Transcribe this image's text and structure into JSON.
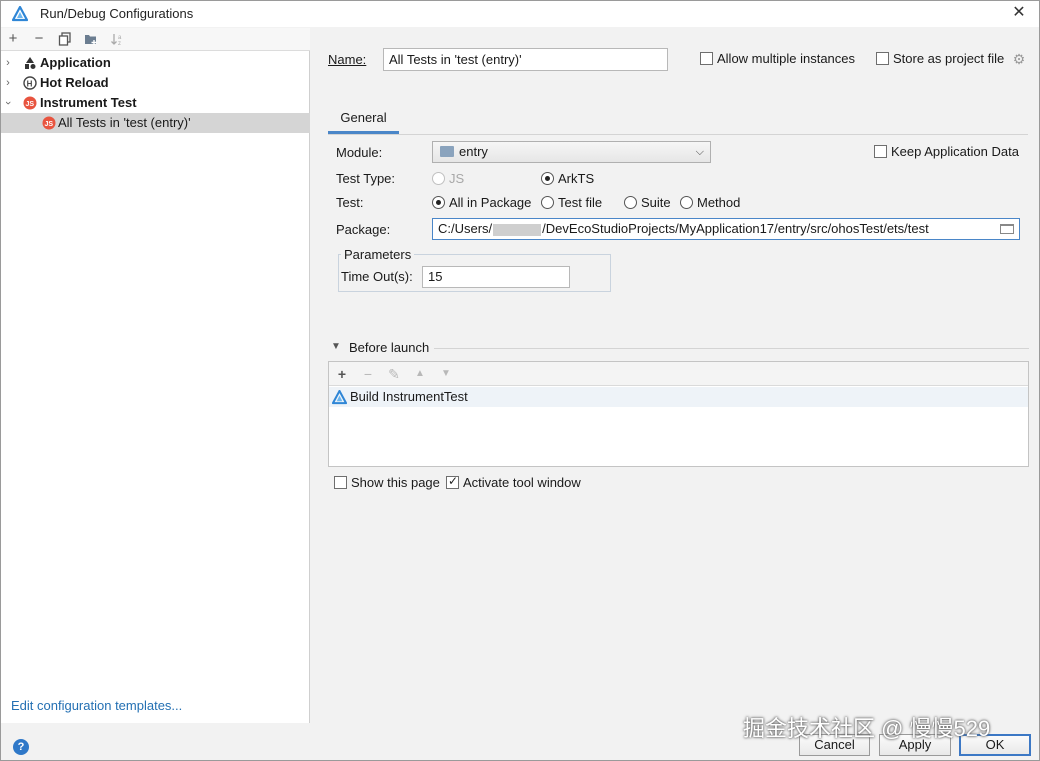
{
  "window": {
    "title": "Run/Debug Configurations",
    "close_icon": "close-icon"
  },
  "left_toolbar": {
    "icons": [
      "plus-icon",
      "minus-icon",
      "copy-icon",
      "folder-add-icon",
      "sort-icon"
    ],
    "plus": "+",
    "minus": "−"
  },
  "tree": {
    "items": [
      {
        "label": "Application",
        "icon": "application-icon",
        "expanded": false
      },
      {
        "label": "Hot Reload",
        "icon": "hot-reload-icon",
        "expanded": false
      },
      {
        "label": "Instrument Test",
        "icon": "js-test-icon",
        "expanded": true
      },
      {
        "label": "All Tests in 'test (entry)'",
        "icon": "js-test-icon",
        "selected": true
      }
    ]
  },
  "edit_templates_link": "Edit configuration templates...",
  "name_field": {
    "label": "Name:",
    "value": "All Tests in 'test (entry)'"
  },
  "allow_multiple": {
    "label": "Allow multiple instances",
    "checked": false
  },
  "store_as_project": {
    "label": "Store as project file",
    "checked": false
  },
  "tabs": [
    {
      "label": "General",
      "active": true
    }
  ],
  "module": {
    "label": "Module:",
    "value": "entry"
  },
  "keep_app_data": {
    "label": "Keep Application Data",
    "checked": false
  },
  "test_type": {
    "label": "Test Type:",
    "options": [
      {
        "label": "JS",
        "selected": false,
        "disabled": true
      },
      {
        "label": "ArkTS",
        "selected": true,
        "disabled": false
      }
    ]
  },
  "test": {
    "label": "Test:",
    "options": [
      {
        "label": "All in Package",
        "selected": true
      },
      {
        "label": "Test file",
        "selected": false
      },
      {
        "label": "Suite",
        "selected": false
      },
      {
        "label": "Method",
        "selected": false
      }
    ]
  },
  "package": {
    "label": "Package:",
    "value_prefix": "C:/Users/",
    "value_suffix": "/DevEcoStudioProjects/MyApplication17/entry/src/ohosTest/ets/test"
  },
  "parameters": {
    "legend": "Parameters",
    "timeout_label": "Time Out(s):",
    "timeout_value": "15"
  },
  "before_launch": {
    "label": "Before launch",
    "tasks": [
      {
        "label": "Build InstrumentTest",
        "icon": "harmony-build-icon"
      }
    ]
  },
  "show_this_page": {
    "label": "Show this page",
    "checked": false
  },
  "activate_tool_window": {
    "label": "Activate tool window",
    "checked": true
  },
  "buttons": {
    "cancel": "Cancel",
    "apply": "Apply",
    "ok": "OK"
  },
  "help_icon": "?",
  "watermark": "掘金技术社区 @ 慢慢529",
  "colors": {
    "accent": "#4a86c8",
    "selection": "#d5d5d5",
    "link": "#2470b3",
    "js_icon": "#e8543f"
  }
}
